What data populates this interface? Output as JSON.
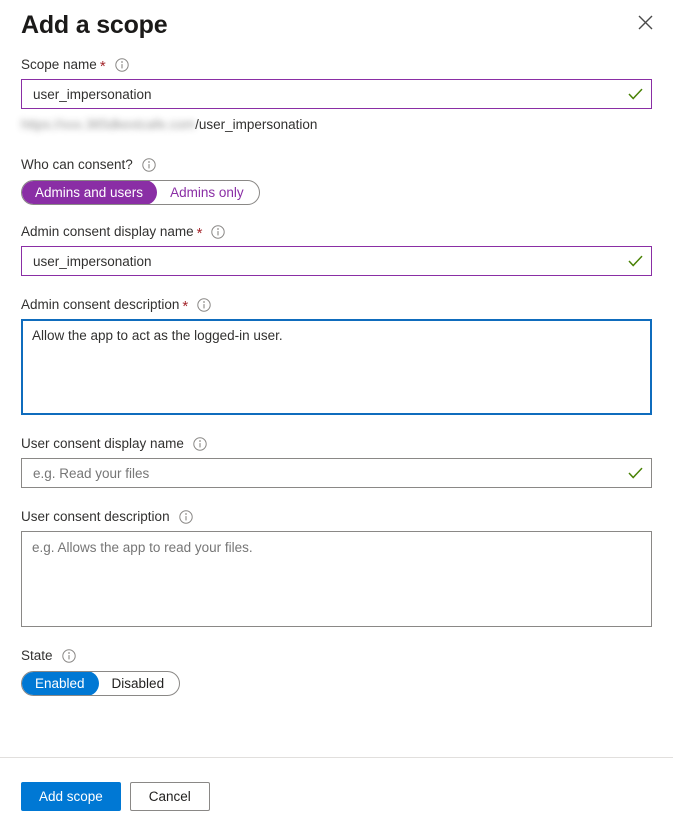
{
  "panel": {
    "title": "Add a scope",
    "close_icon": "close-icon"
  },
  "fields": {
    "scope_name": {
      "label": "Scope name",
      "required_marker": "*",
      "info_icon": "info-icon",
      "value": "user_impersonation",
      "valid_icon": "checkmark-icon",
      "url_prefix_redacted": "https://xxx.365dkextcafe.com",
      "url_suffix": "/user_impersonation"
    },
    "who_can_consent": {
      "label": "Who can consent?",
      "info_icon": "info-icon",
      "options": [
        "Admins and users",
        "Admins only"
      ],
      "selected": "Admins and users"
    },
    "admin_consent_display_name": {
      "label": "Admin consent display name",
      "required_marker": "*",
      "info_icon": "info-icon",
      "value": "user_impersonation",
      "valid_icon": "checkmark-icon"
    },
    "admin_consent_description": {
      "label": "Admin consent description",
      "required_marker": "*",
      "info_icon": "info-icon",
      "value": "Allow the app to act as the logged-in user.",
      "focused": true
    },
    "user_consent_display_name": {
      "label": "User consent display name",
      "info_icon": "info-icon",
      "value": "",
      "placeholder": "e.g. Read your files",
      "valid_icon": "checkmark-icon"
    },
    "user_consent_description": {
      "label": "User consent description",
      "info_icon": "info-icon",
      "value": "",
      "placeholder": "e.g. Allows the app to read your files."
    },
    "state": {
      "label": "State",
      "info_icon": "info-icon",
      "options": [
        "Enabled",
        "Disabled"
      ],
      "selected": "Enabled"
    }
  },
  "footer": {
    "primary_button": "Add scope",
    "secondary_button": "Cancel"
  },
  "colors": {
    "accent_blue": "#0078d4",
    "accent_purple": "#8a2ea5",
    "required_red": "#a4262c",
    "valid_green": "#498205",
    "focus_blue": "#0f6cbd",
    "border_gray": "#8a8886"
  }
}
